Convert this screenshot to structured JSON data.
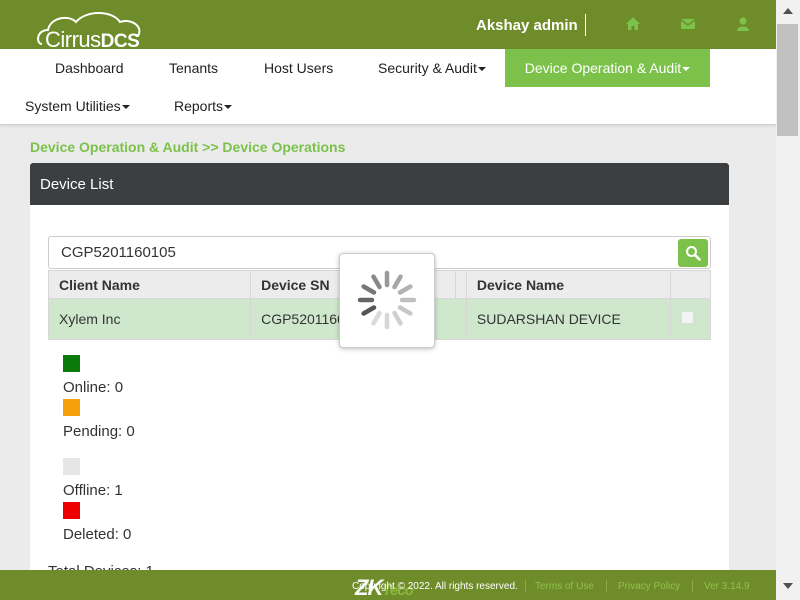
{
  "header": {
    "logo_light": "Cirrus",
    "logo_bold": "DCS",
    "user_name": "Akshay admin",
    "icons": [
      "home-icon",
      "envelope-icon",
      "user-icon"
    ]
  },
  "nav": {
    "items": [
      {
        "label": "Dashboard"
      },
      {
        "label": "Tenants"
      },
      {
        "label": "Host Users"
      },
      {
        "label": "Security & Audit"
      },
      {
        "label": "Device Operation & Audit"
      },
      {
        "label": "System Utilities"
      },
      {
        "label": "Reports"
      }
    ]
  },
  "breadcrumb": "Device Operation & Audit >> Device Operations",
  "panel": {
    "title": "Device List",
    "search_value": "CGP5201160105",
    "columns": [
      "Client Name",
      "Device SN",
      "",
      "Device Name"
    ],
    "rows": [
      {
        "client_name": "Xylem Inc",
        "device_sn": "CGP5201160105",
        "col3": "",
        "device_name": "SUDARSHAN DEVICE"
      }
    ]
  },
  "legend": [
    {
      "label": "Online: 0",
      "color": "#0a7a0a"
    },
    {
      "label": "Pending: 0",
      "color": "#f5a00a"
    },
    {
      "label": "Offline: 1",
      "color": "#e6e6e6"
    },
    {
      "label": "Deleted: 0",
      "color": "#ee0000"
    }
  ],
  "total": "Total Devices: 1",
  "footer": {
    "copyright": "Copyright © 2022. All rights reserved.",
    "terms": "Terms of Use",
    "privacy": "Privacy Policy",
    "version": "Ver 3.14.9"
  },
  "colors": {
    "header_bg": "#6f8c2a",
    "accent": "#7cc24a",
    "row_selected": "#cfe8cd",
    "panel_header": "#3c3f42"
  }
}
